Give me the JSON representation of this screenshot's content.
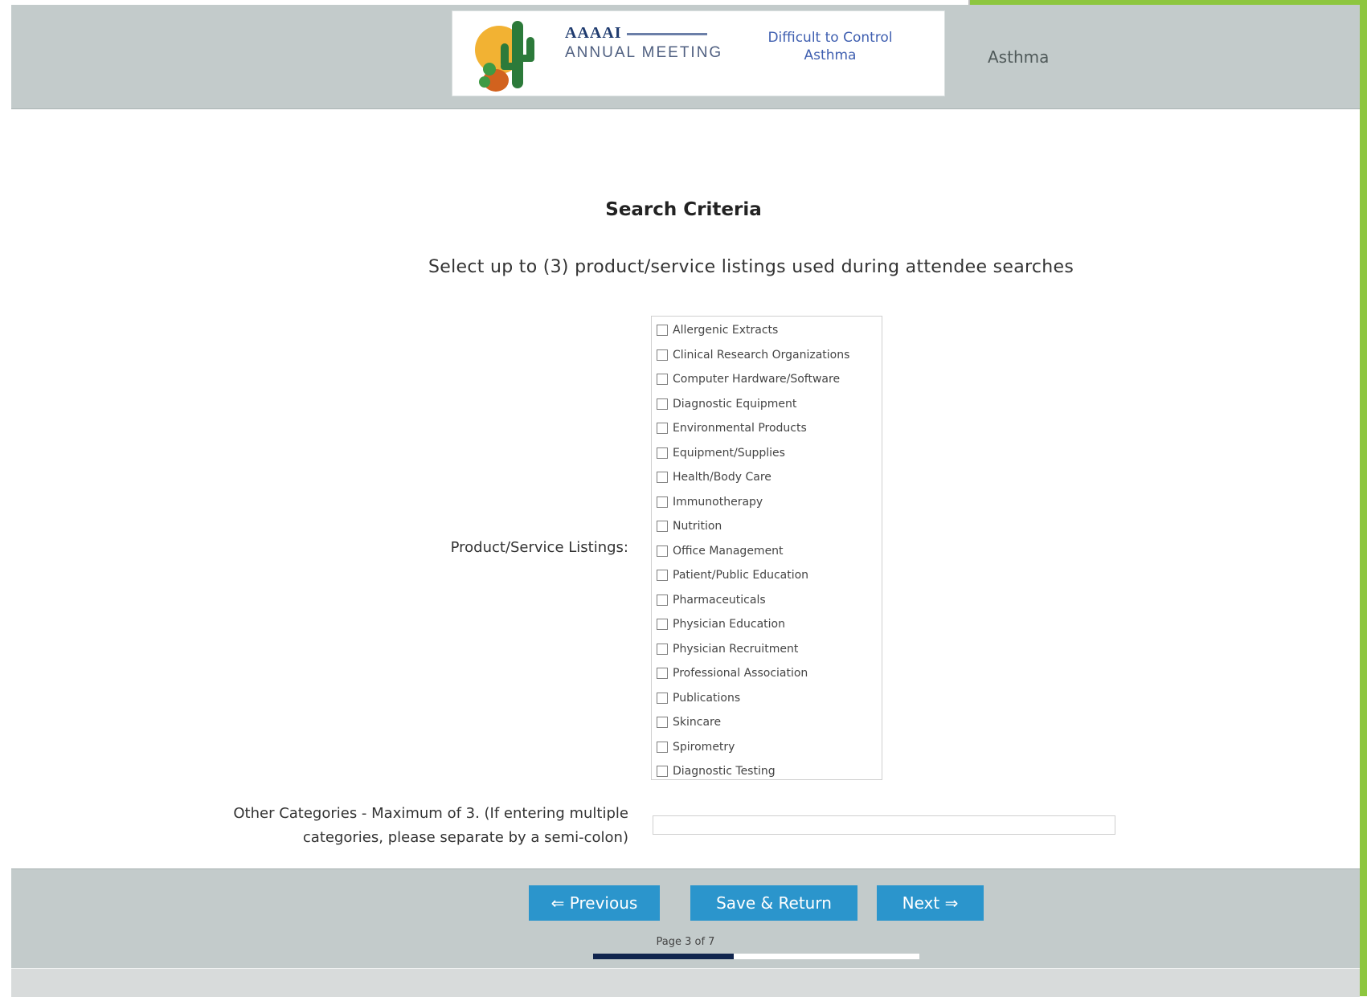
{
  "header": {
    "logo": {
      "org_line1": "AAAAI",
      "org_line2": "ANNUAL MEETING",
      "org_line3": "",
      "dtc_title": "Difficult to Control Asthma",
      "dtc_sub": ""
    },
    "tag": "Asthma"
  },
  "form": {
    "title": "Search Criteria",
    "instructions": "Select up to (3) product/service listings used during attendee searches",
    "listings_label": "Product/Service Listings:",
    "listings": [
      "Allergenic Extracts",
      "Clinical Research Organizations",
      "Computer Hardware/Software",
      "Diagnostic Equipment",
      "Environmental Products",
      "Equipment/Supplies",
      "Health/Body Care",
      "Immunotherapy",
      "Nutrition",
      "Office Management",
      "Patient/Public Education",
      "Pharmaceuticals",
      "Physician Education",
      "Physician Recruitment",
      "Professional Association",
      "Publications",
      "Skincare",
      "Spirometry",
      "Diagnostic Testing"
    ],
    "other_label": "Other Categories - Maximum of 3. (If entering multiple categories, please separate by a semi-colon)",
    "other_value": ""
  },
  "footer": {
    "previous_label": "⇐ Previous",
    "save_label": "Save & Return",
    "next_label": "Next ⇒",
    "page_label": "Page 3 of 7",
    "progress": 0.43
  },
  "colors": {
    "header_bg": "#c3cbcb",
    "button_bg": "#2b95cc",
    "progress_fill": "#10254e",
    "accent_edge": "#8dc63f"
  }
}
